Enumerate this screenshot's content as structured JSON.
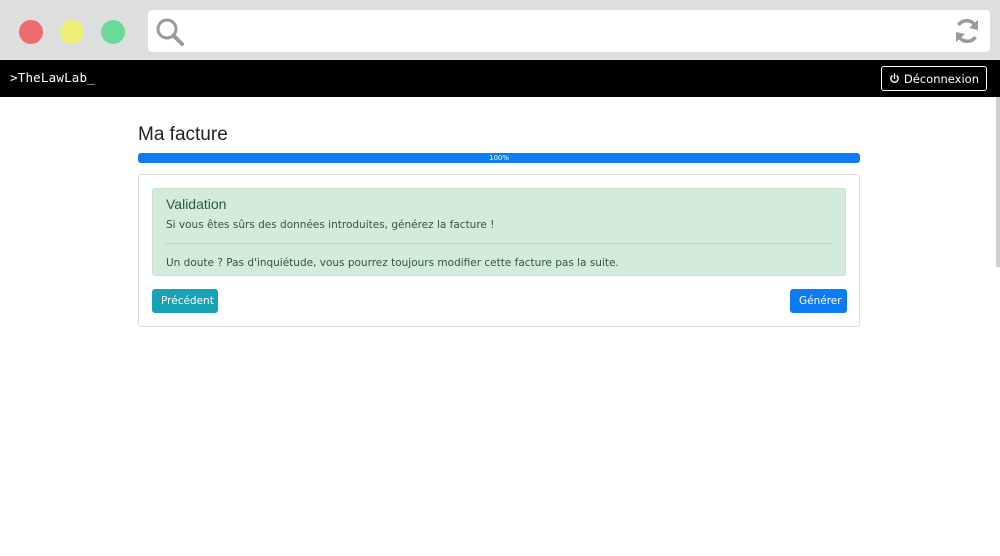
{
  "browser": {
    "url_value": "",
    "icons": {
      "search": "search-icon",
      "reload": "reload-icon"
    },
    "dots": {
      "red": "#ee6b6b",
      "yellow": "#efef7a",
      "green": "#6cd89a"
    }
  },
  "navbar": {
    "brand": ">TheLawLab_",
    "logout_label": "Déconnexion",
    "logout_icon": "power-icon"
  },
  "main": {
    "title": "Ma facture",
    "progress": {
      "value": 100,
      "label": "100%"
    },
    "alert": {
      "heading": "Validation",
      "message": "Si vous êtes sûrs des données introduites, générez la facture !",
      "note": "Un doute ? Pas d'inquiétude, vous pourrez toujours modifier cette facture pas la suite."
    },
    "buttons": {
      "previous": "Précédent",
      "generate": "Générer"
    }
  },
  "colors": {
    "primary": "#0d7bf5",
    "info": "#17a2b8",
    "success_bg": "#d4eadb",
    "success_text": "#2d5a37",
    "navbar_bg": "#000000"
  }
}
